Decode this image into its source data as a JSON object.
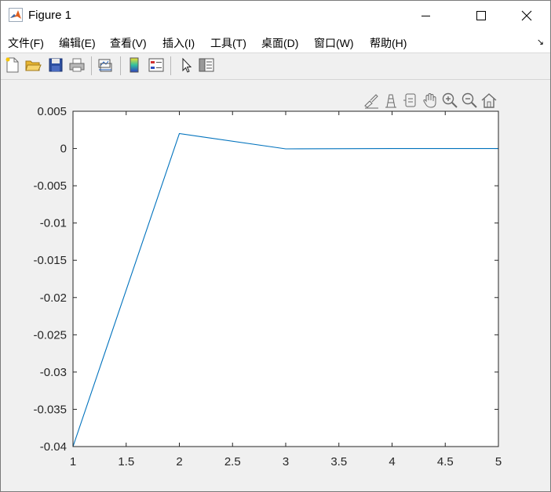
{
  "window": {
    "title": "Figure 1"
  },
  "menu": {
    "items": [
      "文件(F)",
      "编辑(E)",
      "查看(V)",
      "插入(I)",
      "工具(T)",
      "桌面(D)",
      "窗口(W)",
      "帮助(H)"
    ]
  },
  "toolbar": {
    "buttons": [
      "new-figure-icon",
      "open-file-icon",
      "save-icon",
      "print-icon",
      "link-plot-icon",
      "insert-colorbar-icon",
      "insert-legend-icon",
      "edit-plot-arrow-icon",
      "property-inspector-icon"
    ]
  },
  "axes_toolbar": {
    "buttons": [
      "brush-data-icon",
      "data-cursor-icon",
      "rotate-icon",
      "pan-icon",
      "zoom-in-icon",
      "zoom-out-icon",
      "restore-view-icon"
    ]
  },
  "colors": {
    "line": "#0072bd",
    "axis": "#262626",
    "background": "#f0f0f0"
  },
  "chart_data": {
    "type": "line",
    "x": [
      1,
      2,
      3,
      4,
      5
    ],
    "series": [
      {
        "values": [
          -0.04,
          0.002,
          -5e-05,
          -2e-06,
          0
        ]
      }
    ],
    "xlim": [
      1,
      5
    ],
    "ylim": [
      -0.04,
      0.005
    ],
    "xticks": [
      "1",
      "1.5",
      "2",
      "2.5",
      "3",
      "3.5",
      "4",
      "4.5",
      "5"
    ],
    "yticks": [
      "0.005",
      "0",
      "-0.005",
      "-0.01",
      "-0.015",
      "-0.02",
      "-0.025",
      "-0.03",
      "-0.035",
      "-0.04"
    ],
    "grid": false
  }
}
